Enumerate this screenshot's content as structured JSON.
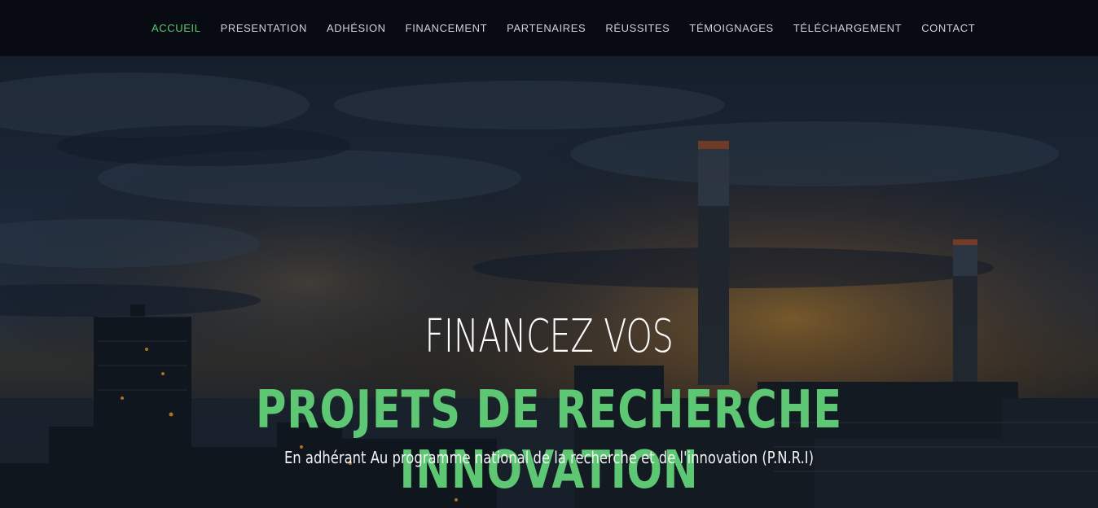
{
  "nav": {
    "items": [
      {
        "label": "ACCUEIL",
        "active": true
      },
      {
        "label": "PRESENTATION",
        "active": false
      },
      {
        "label": "ADHÉSION",
        "active": false
      },
      {
        "label": "FINANCEMENT",
        "active": false
      },
      {
        "label": "PARTENAIRES",
        "active": false
      },
      {
        "label": "RÉUSSITES",
        "active": false
      },
      {
        "label": "TÉMOIGNAGES",
        "active": false
      },
      {
        "label": "TÉLÉCHARGEMENT",
        "active": false
      },
      {
        "label": "CONTACT",
        "active": false
      }
    ]
  },
  "hero": {
    "line1": "FINANCEZ VOS",
    "line2": "PROJETS DE RECHERCHE INNOVATION",
    "line3": "En adhérant Au programme national de la recherche et de l'innovation (P.N.R.I)"
  },
  "colors": {
    "accent": "#5ec774",
    "nav_bg": "#080c12",
    "nav_text": "#cfd3d8"
  }
}
